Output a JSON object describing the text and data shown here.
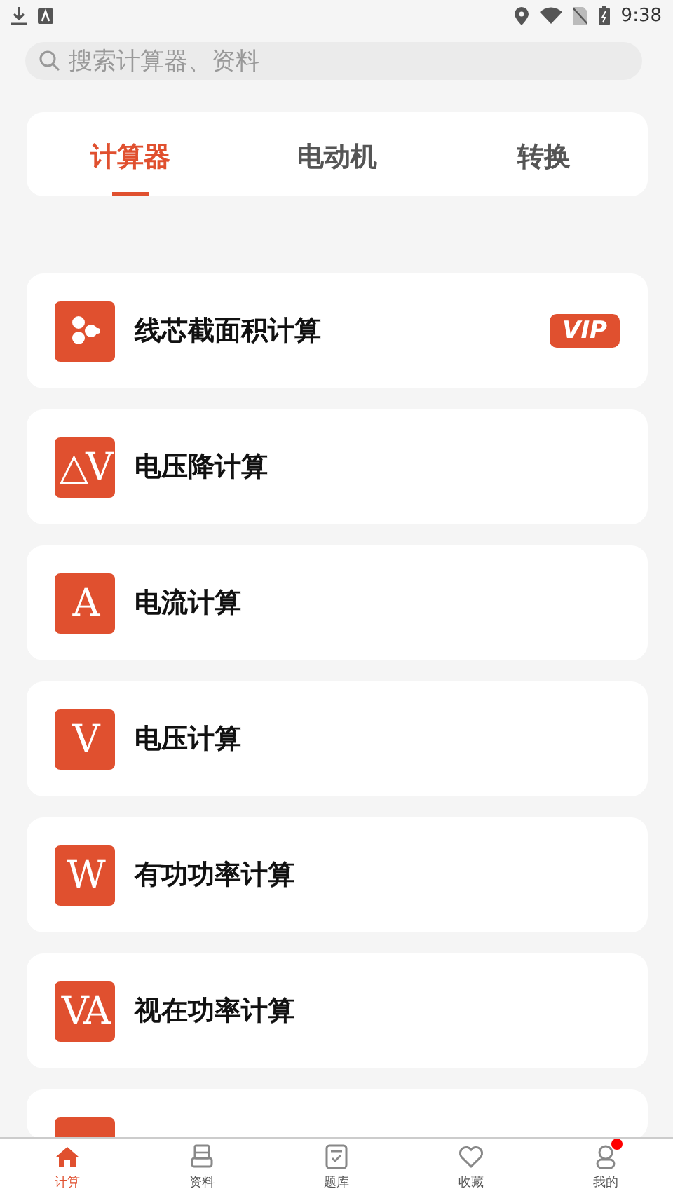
{
  "status_bar": {
    "time": "9:38"
  },
  "search": {
    "placeholder": "搜索计算器、资料"
  },
  "tabs": [
    {
      "label": "计算器",
      "selected": true
    },
    {
      "label": "电动机",
      "selected": false
    },
    {
      "label": "转换",
      "selected": false
    }
  ],
  "calculators": [
    {
      "kind": "dots",
      "title": "线芯截面积计算",
      "vip": true
    },
    {
      "kind": "symbol",
      "symbol": "△V",
      "title": "电压降计算",
      "vip": false
    },
    {
      "kind": "symbol",
      "symbol": "A",
      "title": "电流计算",
      "vip": false
    },
    {
      "kind": "symbol",
      "symbol": "V",
      "title": "电压计算",
      "vip": false
    },
    {
      "kind": "symbol",
      "symbol": "W",
      "title": "有功功率计算",
      "vip": false
    },
    {
      "kind": "symbol",
      "symbol": "VA",
      "title": "视在功率计算",
      "vip": false
    },
    {
      "kind": "cut"
    }
  ],
  "vip_label": "VIP",
  "nav": [
    {
      "label": "计算",
      "selected": true,
      "badge": false
    },
    {
      "label": "资料",
      "selected": false,
      "badge": false
    },
    {
      "label": "题库",
      "selected": false,
      "badge": false
    },
    {
      "label": "收藏",
      "selected": false,
      "badge": false
    },
    {
      "label": "我的",
      "selected": false,
      "badge": true
    }
  ]
}
